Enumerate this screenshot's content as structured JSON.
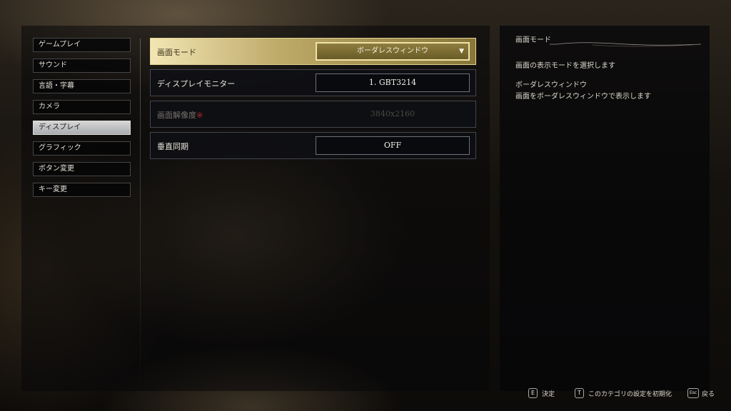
{
  "nav": {
    "items": [
      {
        "label": "ゲームプレイ",
        "active": false
      },
      {
        "label": "サウンド",
        "active": false
      },
      {
        "label": "言語・字幕",
        "active": false
      },
      {
        "label": "カメラ",
        "active": false
      },
      {
        "label": "ディスプレイ",
        "active": true
      },
      {
        "label": "グラフィック",
        "active": false
      },
      {
        "label": "ボタン変更",
        "active": false
      },
      {
        "label": "キー変更",
        "active": false
      }
    ]
  },
  "settings": {
    "screen_mode": {
      "label": "画面モード",
      "value": "ボーダレスウィンドウ"
    },
    "display_monitor": {
      "label": "ディスプレイモニター",
      "value": "1. GBT3214"
    },
    "resolution": {
      "label": "画面解像度",
      "marker": "※",
      "value": "3840x2160"
    },
    "vsync": {
      "label": "垂直同期",
      "value": "OFF"
    }
  },
  "detail": {
    "title": "画面モード",
    "description": "画面の表示モードを選択します",
    "option_name": "ボーダレスウィンドウ",
    "option_description": "画面をボーダレスウィンドウで表示します"
  },
  "footer": {
    "confirm": {
      "key": "E",
      "label": "決定"
    },
    "reset": {
      "key": "T",
      "label": "このカテゴリの設定を初期化"
    },
    "back": {
      "key": "Esc",
      "label": "戻る"
    }
  },
  "colors": {
    "accent_gold": "#c9b46f",
    "active_tab": "#c4c5c8",
    "required_marker": "#b02a2a"
  }
}
